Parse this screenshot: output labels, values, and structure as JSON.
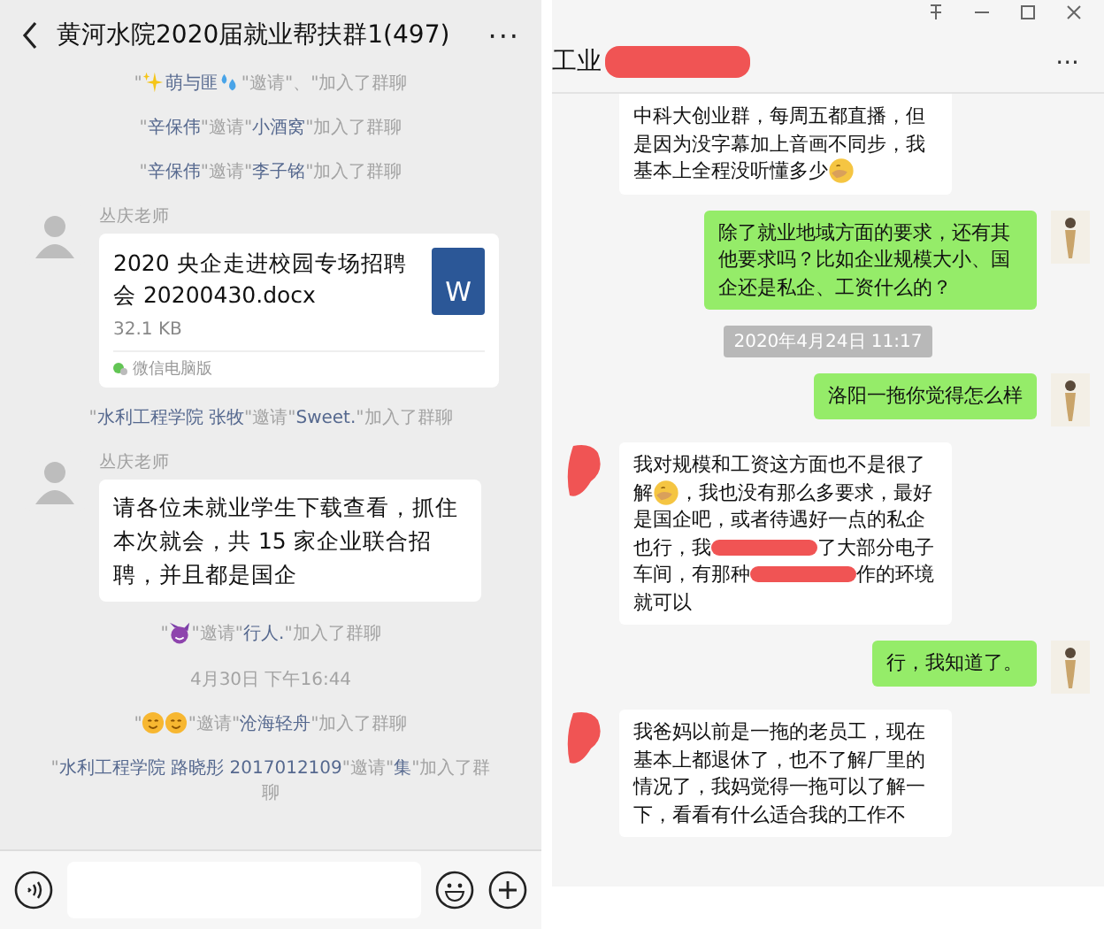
{
  "left": {
    "title": "黄河水院2020届就业帮扶群1(497)",
    "more": "···",
    "messages": [
      {
        "kind": "system",
        "parts": [
          {
            "kind": "text",
            "text": "\""
          },
          {
            "kind": "sparkles"
          },
          {
            "kind": "name",
            "text": "萌与匪"
          },
          {
            "kind": "sweat"
          },
          {
            "kind": "text",
            "text": "\"邀请\"、\"加入了群聊"
          }
        ]
      },
      {
        "kind": "system",
        "parts": [
          {
            "kind": "text",
            "text": "\""
          },
          {
            "kind": "name",
            "text": "辛保伟"
          },
          {
            "kind": "text",
            "text": "\"邀请\""
          },
          {
            "kind": "name",
            "text": "小酒窝"
          },
          {
            "kind": "text",
            "text": "\"加入了群聊"
          }
        ]
      },
      {
        "kind": "system",
        "parts": [
          {
            "kind": "text",
            "text": "\""
          },
          {
            "kind": "name",
            "text": "辛保伟"
          },
          {
            "kind": "text",
            "text": "\"邀请\""
          },
          {
            "kind": "name",
            "text": "李子铭"
          },
          {
            "kind": "text",
            "text": "\"加入了群聊"
          }
        ]
      },
      {
        "kind": "file",
        "sender": "丛庆老师",
        "file_name": "2020 央企走进校园专场招聘会 20200430.docx",
        "size": "32.1 KB",
        "source": "微信电脑版",
        "icon_label": "W"
      },
      {
        "kind": "system",
        "parts": [
          {
            "kind": "text",
            "text": "\""
          },
          {
            "kind": "name",
            "text": "水利工程学院 张牧"
          },
          {
            "kind": "text",
            "text": "\"邀请\""
          },
          {
            "kind": "name",
            "text": "Sweet."
          },
          {
            "kind": "text",
            "text": "\"加入了群聊"
          }
        ]
      },
      {
        "kind": "text",
        "sender": "丛庆老师",
        "text": "请各位未就业学生下载查看，抓住本次就会，共 15 家企业联合招聘，并且都是国企"
      },
      {
        "kind": "system",
        "parts": [
          {
            "kind": "text",
            "text": "\""
          },
          {
            "kind": "devil"
          },
          {
            "kind": "text",
            "text": "\"邀请\""
          },
          {
            "kind": "name",
            "text": "行人."
          },
          {
            "kind": "text",
            "text": "\"加入了群聊"
          }
        ]
      },
      {
        "kind": "time",
        "text": "4月30日 下午16:44"
      },
      {
        "kind": "system",
        "parts": [
          {
            "kind": "text",
            "text": "\""
          },
          {
            "kind": "smile"
          },
          {
            "kind": "smile"
          },
          {
            "kind": "text",
            "text": "\"邀请\""
          },
          {
            "kind": "name",
            "text": "沧海轻舟"
          },
          {
            "kind": "text",
            "text": "\"加入了群聊"
          }
        ]
      },
      {
        "kind": "system",
        "parts": [
          {
            "kind": "text",
            "text": "\""
          },
          {
            "kind": "name",
            "text": "水利工程学院 路晓彤 2017012109"
          },
          {
            "kind": "text",
            "text": "\"邀请\""
          },
          {
            "kind": "name",
            "text": "集"
          },
          {
            "kind": "text",
            "text": "\"加入了群聊"
          }
        ]
      }
    ]
  },
  "right": {
    "title": "工业",
    "more": "···",
    "messages": [
      {
        "kind": "continued",
        "parts": [
          {
            "kind": "text",
            "text": "中科大创业群，每周五都直播，但是因为没字幕加上音画不同步，我基本上全程没听懂多少"
          },
          {
            "kind": "facepalm"
          }
        ]
      },
      {
        "kind": "sent",
        "parts": [
          {
            "kind": "text",
            "text": "除了就业地域方面的要求，还有其他要求吗？比如企业规模大小、国企还是私企、工资什么的？"
          }
        ]
      },
      {
        "kind": "time",
        "text": "2020年4月24日 11:17"
      },
      {
        "kind": "sent",
        "parts": [
          {
            "kind": "text",
            "text": "洛阳一拖你觉得怎么样"
          }
        ]
      },
      {
        "kind": "received",
        "parts": [
          {
            "kind": "text",
            "text": "我对规模和工资这方面也不是很了解"
          },
          {
            "kind": "facepalm"
          },
          {
            "kind": "text",
            "text": "，我也没有那么多要求，最好是国企吧，或者待遇好一点的私企也行，我"
          },
          {
            "kind": "redaction"
          },
          {
            "kind": "text",
            "text": "了大部分电子车间，有那种"
          },
          {
            "kind": "redaction"
          },
          {
            "kind": "text",
            "text": "作的环境就可以"
          }
        ]
      },
      {
        "kind": "sent",
        "parts": [
          {
            "kind": "text",
            "text": "行，我知道了。"
          }
        ]
      },
      {
        "kind": "received",
        "parts": [
          {
            "kind": "text",
            "text": "我爸妈以前是一拖的老员工，现在基本上都退休了，也不了解厂里的情况了，我妈觉得一拖可以了解一下，看看有什么适合我的工作不"
          }
        ]
      }
    ]
  }
}
